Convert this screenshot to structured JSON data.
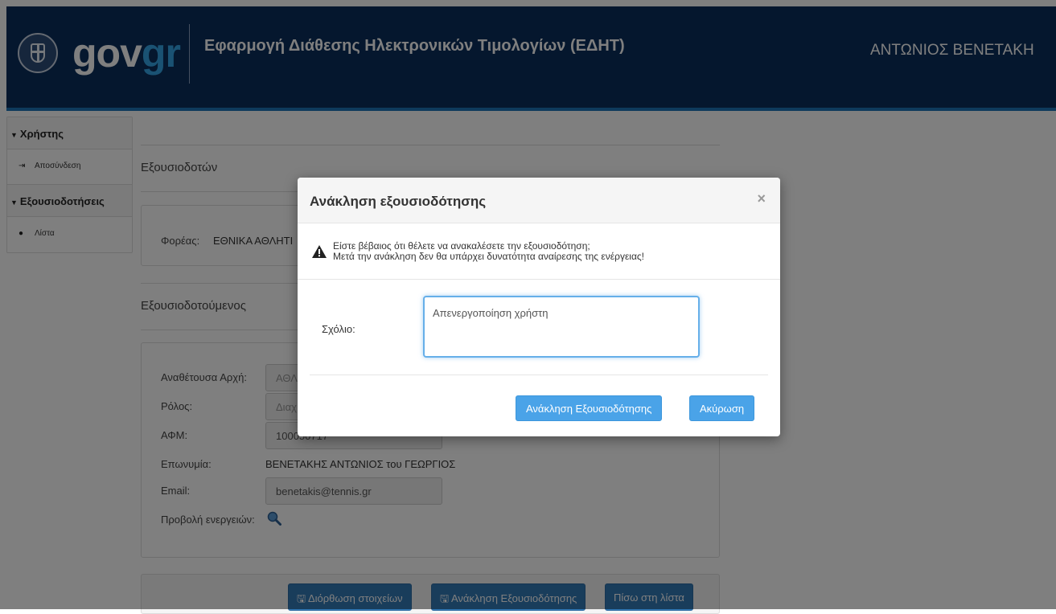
{
  "header": {
    "logo_gov": "gov",
    "logo_gr": "gr",
    "app_title": "Εφαρμογή Διάθεσης Ηλεκτρονικών Τιμολογίων (ΕΔΗΤ)",
    "user_name": "ΑΝΤΩΝΙΟΣ ΒΕΝΕΤΑΚΗ"
  },
  "sidebar": {
    "user_section": "Χρήστης",
    "logout": "Αποσύνδεση",
    "auth_section": "Εξουσιοδοτήσεις",
    "list": "Λίστα"
  },
  "form": {
    "authorizers_title": "Εξουσιοδοτών",
    "agency_label": "Φορέας:",
    "agency_value": "ΕΘΝΙΚΑ ΑΘΛΗΤΙ",
    "authorized_title": "Εξουσιοδοτούμενος",
    "contracting_label": "Αναθέτουσα Αρχή:",
    "contracting_value": "ΑΘΛ",
    "role_label": "Ρόλος:",
    "role_value": "Διαχ",
    "afm_label": "ΑΦΜ:",
    "afm_value": "100050717",
    "surname_label": "Επωνυμία:",
    "surname_value": "ΒΕΝΕΤΑΚΗΣ ΑΝΤΩΝΙΟΣ του ΓΕΩΡΓΙΟΣ",
    "email_label": "Email:",
    "email_value": "benetakis@tennis.gr",
    "actions_label": "Προβολή ενεργειών:"
  },
  "buttons": {
    "edit": "Διόρθωση στοιχείων",
    "revoke": "Ανάκληση Εξουσιοδότησης",
    "back": "Πίσω στη λίστα"
  },
  "modal": {
    "title": "Ανάκληση εξουσιοδότησης",
    "close": "×",
    "warning_line1": "Είστε βέβαιος ότι θέλετε να ανακαλέσετε την εξουσιοδότηση;",
    "warning_line2": "Μετά την ανάκληση δεν θα υπάρχει δυνατότητα αναίρεσης της ενέργειας!",
    "comment_label": "Σχόλιο:",
    "comment_value": "Απενεργοποίηση χρήστη",
    "confirm_button": "Ανάκληση Εξουσιοδότησης",
    "cancel_button": "Ακύρωση"
  },
  "colors": {
    "header_bg": "#0b2e5c",
    "accent": "#35a4e6",
    "primary_button": "#337ab7",
    "modal_button": "#4aa3e8"
  }
}
